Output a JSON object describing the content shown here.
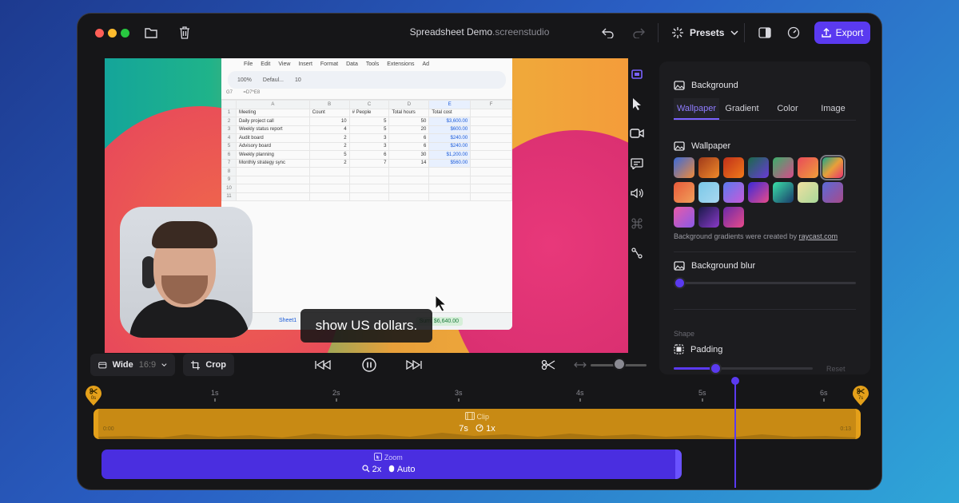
{
  "window": {
    "title_main": "Spreadsheet Demo",
    "title_ext": ".screenstudio"
  },
  "toolbar": {
    "presets_label": "Presets",
    "export_label": "Export"
  },
  "sheet": {
    "menu": [
      "File",
      "Edit",
      "View",
      "Insert",
      "Format",
      "Data",
      "Tools",
      "Extensions",
      "Ad"
    ],
    "toolbar_zoom": "100%",
    "toolbar_font": "Defaul...",
    "toolbar_size": "10",
    "formula_ref": "G7",
    "formula": "=D7*E8",
    "columns": [
      "",
      "A",
      "B",
      "C",
      "D",
      "E",
      "F"
    ],
    "rows": [
      [
        "1",
        "Meeting",
        "Count",
        "# People",
        "Total hours",
        "Total cost",
        ""
      ],
      [
        "2",
        "Daily project call",
        "10",
        "5",
        "50",
        "$3,600.00",
        ""
      ],
      [
        "3",
        "Weekly status report",
        "4",
        "5",
        "20",
        "$600.00",
        ""
      ],
      [
        "4",
        "Audit board",
        "2",
        "3",
        "6",
        "$240.00",
        ""
      ],
      [
        "5",
        "Advisory board",
        "2",
        "3",
        "6",
        "$240.00",
        ""
      ],
      [
        "6",
        "Weekly planning",
        "5",
        "6",
        "30",
        "$1,200.00",
        ""
      ],
      [
        "7",
        "Monthly strategy sync",
        "2",
        "7",
        "14",
        "$560.00",
        ""
      ],
      [
        "8",
        "",
        "",
        "",
        "",
        "",
        ""
      ],
      [
        "9",
        "",
        "",
        "",
        "",
        "",
        ""
      ],
      [
        "10",
        "",
        "",
        "",
        "",
        "",
        ""
      ],
      [
        "11",
        "",
        "",
        "",
        "",
        "",
        ""
      ]
    ],
    "sheet_tab": "Sheet1",
    "sum": "Sum: $6,640.00"
  },
  "caption": "show US dollars.",
  "panel": {
    "background_title": "Background",
    "tabs": [
      "Wallpaper",
      "Gradient",
      "Color",
      "Image"
    ],
    "wallpaper_title": "Wallpaper",
    "credit_prefix": "Background gradients were created by ",
    "credit_link": "raycast.com",
    "blur_title": "Background blur",
    "blur_value": 0,
    "shape_label": "Shape",
    "padding_title": "Padding",
    "padding_value": 0.23,
    "reset_label": "Reset"
  },
  "controls": {
    "aspect_label": "Wide",
    "aspect_ratio": "16:9",
    "crop_label": "Crop"
  },
  "timeline": {
    "ruler": [
      "1s",
      "2s",
      "3s",
      "4s",
      "5s",
      "6s"
    ],
    "marker_start": "0s",
    "marker_end": "7s",
    "clip_label": "Clip",
    "clip_duration": "7s",
    "clip_speed": "1x",
    "clip_start": "0:00",
    "clip_end": "0:13",
    "zoom_label": "Zoom",
    "zoom_level": "2x",
    "zoom_mode": "Auto"
  },
  "colors": {
    "accent": "#5a3af0",
    "clip": "#c88a14",
    "zoom": "#4a2ee0"
  }
}
